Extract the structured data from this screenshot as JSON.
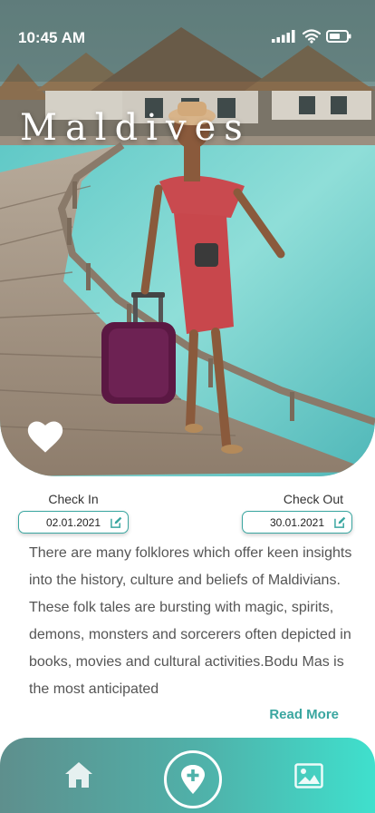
{
  "status_bar": {
    "time": "10:45 AM"
  },
  "hero": {
    "title": "Maldives"
  },
  "dates": {
    "check_in": {
      "label": "Check In",
      "value": "02.01.2021"
    },
    "check_out": {
      "label": "Check Out",
      "value": "30.01.2021"
    }
  },
  "description": {
    "text": "There are many folklores which offer keen insights into the history, culture and beliefs of Maldivians. These folk tales are bursting with magic, spirits, demons, monsters and sorcerers often depicted in books, movies and cultural activities.Bodu Mas is the most anticipated",
    "read_more": "Read More"
  },
  "icons": {
    "status": [
      "signal-icon",
      "wifi-icon",
      "battery-icon"
    ],
    "hero": [
      "heart-icon"
    ],
    "dates": [
      "edit-icon"
    ],
    "nav": [
      "home-icon",
      "add-location-icon",
      "image-icon"
    ]
  },
  "colors": {
    "accent": "#3aa6a0",
    "nav_start": "#5e8f8d",
    "nav_end": "#3fe0cd"
  }
}
